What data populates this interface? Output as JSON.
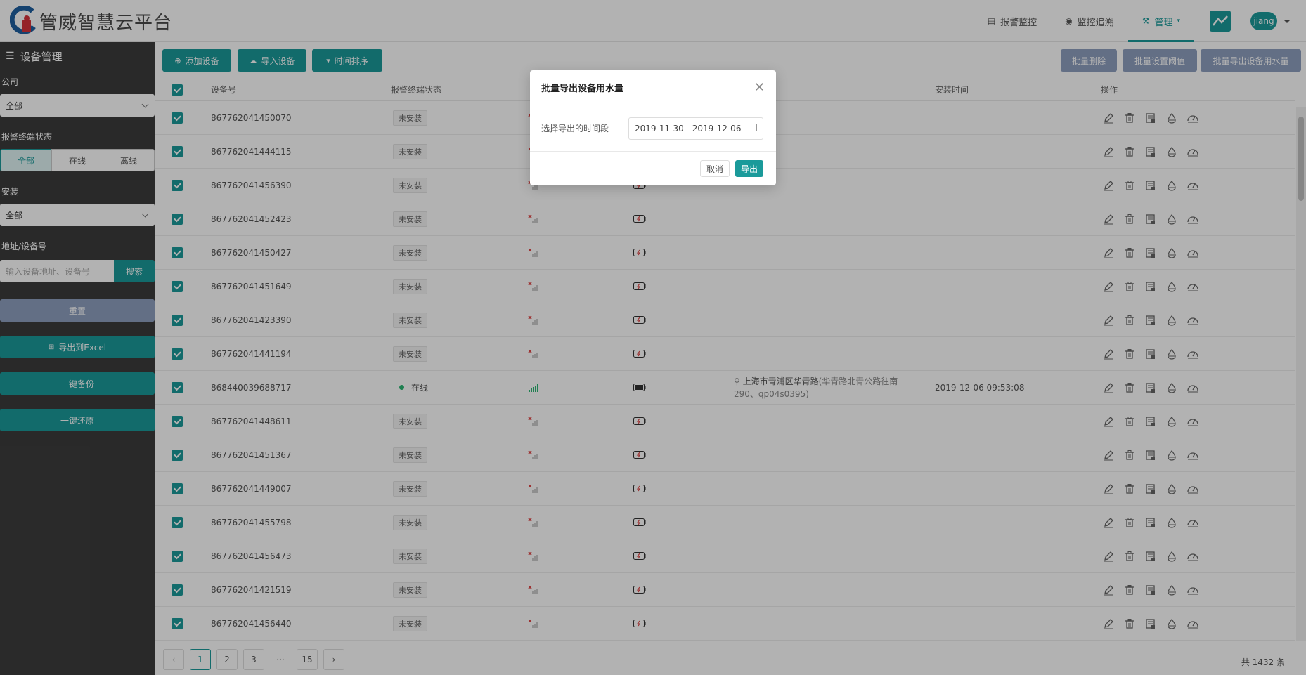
{
  "app": {
    "title": "管威智慧云平台"
  },
  "nav": {
    "items": [
      {
        "label": "报警监控",
        "icon": "clipboard-icon"
      },
      {
        "label": "监控追溯",
        "icon": "eye-icon"
      },
      {
        "label": "管理",
        "icon": "tools-icon"
      }
    ],
    "user": "jiang"
  },
  "sidebar": {
    "title": "设备管理",
    "company_label": "公司",
    "company_value": "全部",
    "status_label": "报警终端状态",
    "status_options": [
      "全部",
      "在线",
      "离线"
    ],
    "install_label": "安装",
    "install_value": "全部",
    "search_label": "地址/设备号",
    "search_placeholder": "输入设备地址、设备号",
    "search_button": "搜索",
    "reset_button": "重置",
    "export_excel": "导出到Excel",
    "backup": "一键备份",
    "restore": "一键还原"
  },
  "toolbar": {
    "add": "添加设备",
    "import": "导入设备",
    "sort": "时间排序",
    "batch_delete": "批量删除",
    "batch_threshold": "批量设置阈值",
    "batch_export": "批量导出设备用水量"
  },
  "table": {
    "headers": {
      "device": "设备号",
      "status": "报警终端状态",
      "install_time": "安装时间",
      "ops": "操作"
    },
    "rows": [
      {
        "device": "867762041450070",
        "status": "未安装",
        "online": false,
        "address": "",
        "address_detail": "",
        "time": ""
      },
      {
        "device": "867762041444115",
        "status": "未安装",
        "online": false,
        "address": "",
        "address_detail": "",
        "time": ""
      },
      {
        "device": "867762041456390",
        "status": "未安装",
        "online": false,
        "address": "",
        "address_detail": "",
        "time": ""
      },
      {
        "device": "867762041452423",
        "status": "未安装",
        "online": false,
        "address": "",
        "address_detail": "",
        "time": ""
      },
      {
        "device": "867762041450427",
        "status": "未安装",
        "online": false,
        "address": "",
        "address_detail": "",
        "time": ""
      },
      {
        "device": "867762041451649",
        "status": "未安装",
        "online": false,
        "address": "",
        "address_detail": "",
        "time": ""
      },
      {
        "device": "867762041423390",
        "status": "未安装",
        "online": false,
        "address": "",
        "address_detail": "",
        "time": ""
      },
      {
        "device": "867762041441194",
        "status": "未安装",
        "online": false,
        "address": "",
        "address_detail": "",
        "time": ""
      },
      {
        "device": "868440039688717",
        "status": "在线",
        "online": true,
        "address": "上海市青浦区华青路",
        "address_detail": "(华青路北青公路往南290、qp04s0395)",
        "time": "2019-12-06 09:53:08"
      },
      {
        "device": "867762041448611",
        "status": "未安装",
        "online": false,
        "address": "",
        "address_detail": "",
        "time": ""
      },
      {
        "device": "867762041451367",
        "status": "未安装",
        "online": false,
        "address": "",
        "address_detail": "",
        "time": ""
      },
      {
        "device": "867762041449007",
        "status": "未安装",
        "online": false,
        "address": "",
        "address_detail": "",
        "time": ""
      },
      {
        "device": "867762041455798",
        "status": "未安装",
        "online": false,
        "address": "",
        "address_detail": "",
        "time": ""
      },
      {
        "device": "867762041456473",
        "status": "未安装",
        "online": false,
        "address": "",
        "address_detail": "",
        "time": ""
      },
      {
        "device": "867762041421519",
        "status": "未安装",
        "online": false,
        "address": "",
        "address_detail": "",
        "time": ""
      },
      {
        "device": "867762041456440",
        "status": "未安装",
        "online": false,
        "address": "",
        "address_detail": "",
        "time": ""
      }
    ]
  },
  "pager": {
    "pages": [
      "1",
      "2",
      "3",
      "···",
      "15"
    ],
    "current": "1",
    "total": "共 1432 条"
  },
  "modal": {
    "title": "批量导出设备用水量",
    "label": "选择导出的时间段",
    "date_range": "2019-11-30 - 2019-12-06",
    "cancel": "取消",
    "confirm": "导出"
  },
  "colors": {
    "accent": "#1a9a9a",
    "grey_button": "#8e9fbf",
    "sidebar": "#3c3c3c",
    "online": "#2bb673",
    "alert": "#e04848"
  }
}
